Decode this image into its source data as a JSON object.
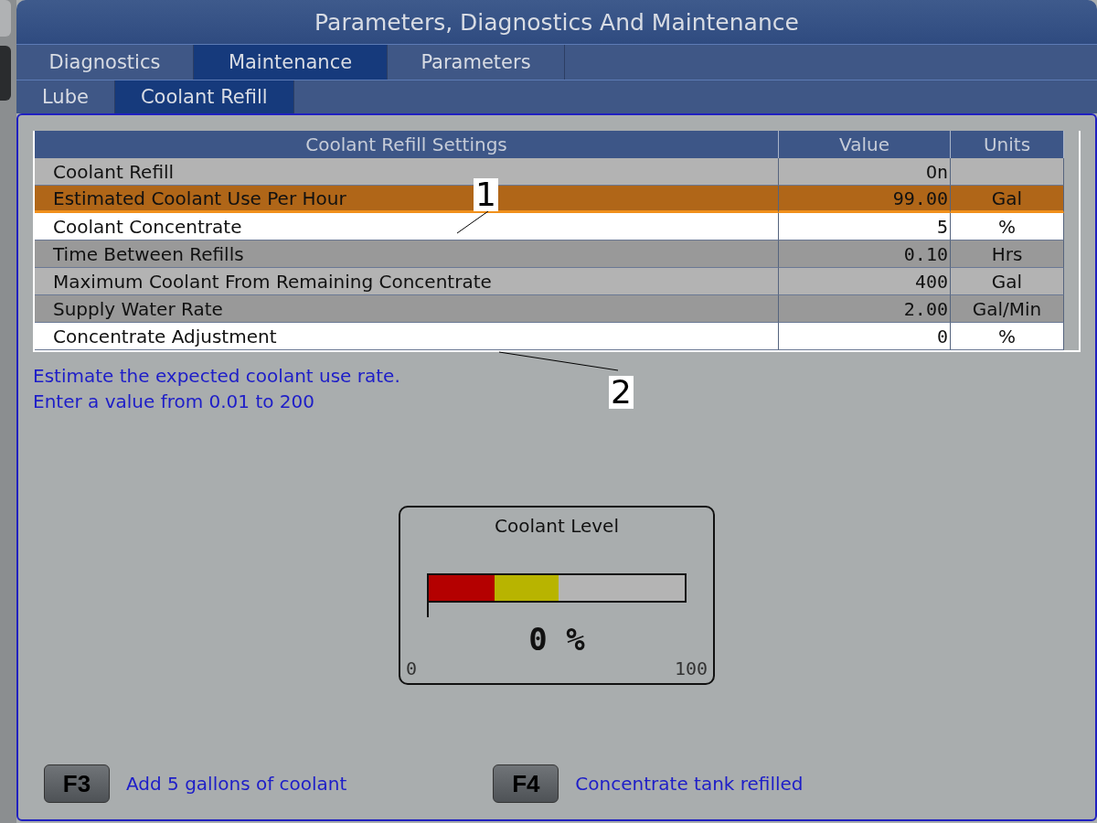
{
  "window": {
    "title": "Parameters, Diagnostics And Maintenance"
  },
  "tabs": [
    {
      "label": "Diagnostics",
      "selected": false
    },
    {
      "label": "Maintenance",
      "selected": true
    },
    {
      "label": "Parameters",
      "selected": false
    }
  ],
  "subtabs": [
    {
      "label": "Lube",
      "selected": false
    },
    {
      "label": "Coolant Refill",
      "selected": true
    }
  ],
  "table": {
    "columns": [
      "Coolant Refill Settings",
      "Value",
      "Units"
    ],
    "rows": [
      {
        "name": "Coolant Refill",
        "value": "On",
        "units": "",
        "kind": "light",
        "selected": false
      },
      {
        "name": "Estimated Coolant Use Per Hour",
        "value": "99.00",
        "units": "Gal",
        "selected": true
      },
      {
        "name": "Coolant Concentrate",
        "value": "5",
        "units": "%",
        "kind": "white",
        "selected": false
      },
      {
        "name": "Time Between Refills",
        "value": "0.10",
        "units": "Hrs",
        "kind": "dark",
        "selected": false
      },
      {
        "name": "Maximum Coolant From Remaining Concentrate",
        "value": "400",
        "units": "Gal",
        "kind": "light",
        "selected": false
      },
      {
        "name": "Supply Water Rate",
        "value": "2.00",
        "units": "Gal/Min",
        "kind": "dark",
        "selected": false
      },
      {
        "name": "Concentrate Adjustment",
        "value": "0",
        "units": "%",
        "kind": "white",
        "selected": false
      }
    ]
  },
  "callouts": [
    {
      "label": "1"
    },
    {
      "label": "2"
    }
  ],
  "help": [
    "Estimate the expected coolant use rate.",
    "Enter a value from 0.01 to 200"
  ],
  "gauge": {
    "title": "Coolant Level",
    "level": 0,
    "reading": "0 %",
    "min": "0",
    "max": "100"
  },
  "keys": [
    {
      "key": "F3",
      "label": "Add 5 gallons of coolant"
    },
    {
      "key": "F4",
      "label": "Concentrate tank refilled"
    }
  ]
}
